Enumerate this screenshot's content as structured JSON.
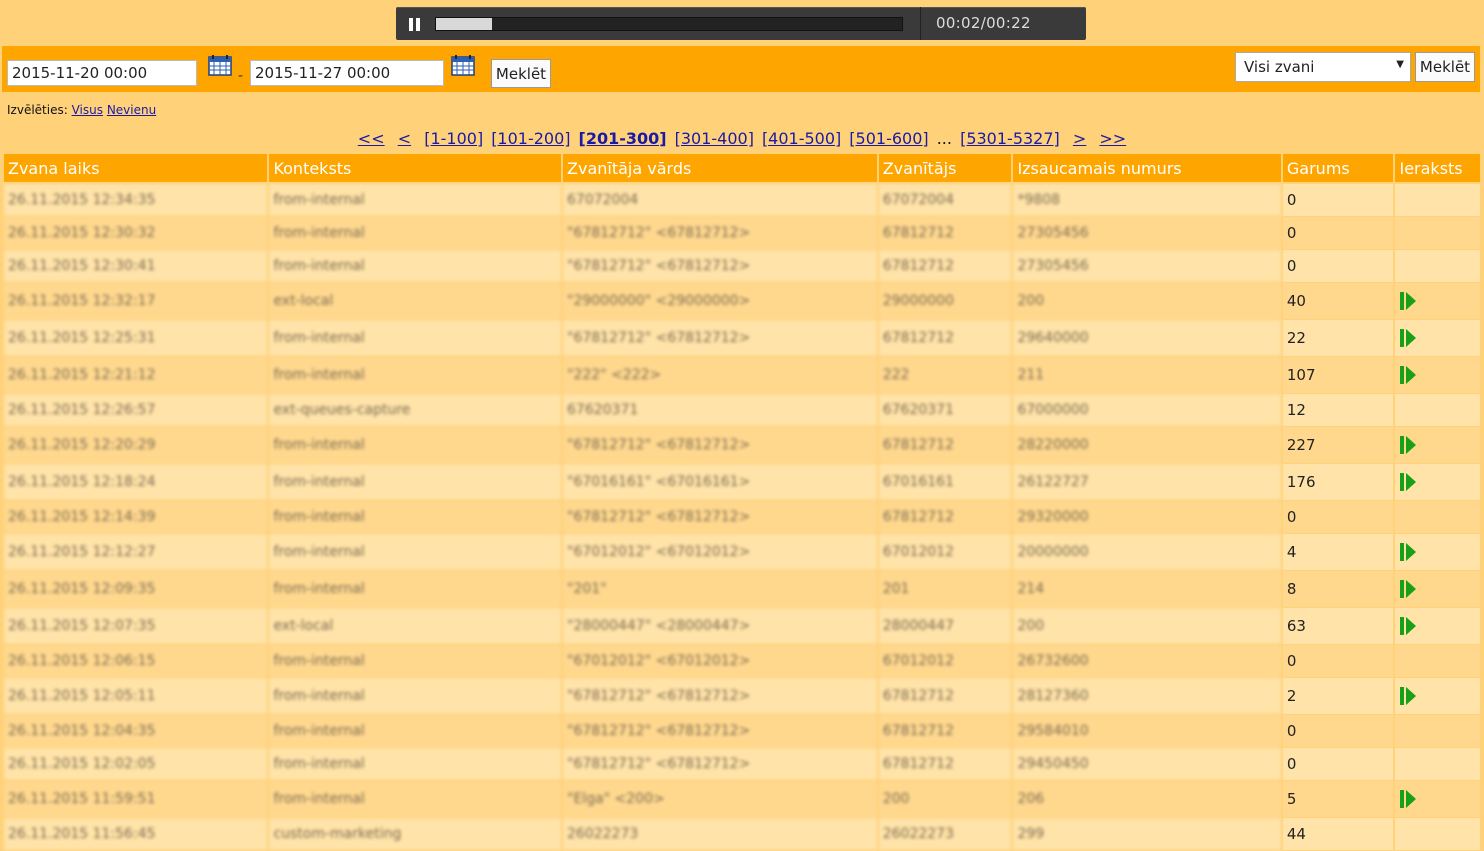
{
  "player": {
    "time": "00:02/00:22",
    "progress": 0.12
  },
  "filter": {
    "date_from": "2015-11-20 00:00",
    "separator": "-",
    "date_to": "2015-11-27 00:00",
    "search_label": "Meklēt",
    "call_filter": "Visi zvani",
    "search_label2": "Meklēt"
  },
  "choose": {
    "label": "Izvēlēties:",
    "all": "Visus",
    "none": "Nevienu"
  },
  "pager": {
    "first": "<<",
    "prev": "<",
    "pages": [
      "[1-100]",
      "[101-200]",
      "[201-300]",
      "[301-400]",
      "[401-500]",
      "[501-600]"
    ],
    "current_index": 2,
    "ellipsis": "...",
    "last_page": "[5301-5327]",
    "next": ">",
    "last": ">>"
  },
  "table": {
    "headers": [
      "Zvana laiks",
      "Konteksts",
      "Zvanītāja vārds",
      "Zvanītājs",
      "Izsaucamais numurs",
      "Garums",
      "Ieraksts"
    ],
    "rows": [
      {
        "time": "26.11.2015 12:34:35",
        "context": "from-internal",
        "name": "67072004",
        "caller": "67072004",
        "callee": "*9808",
        "duration": "0",
        "rec": false
      },
      {
        "time": "26.11.2015 12:30:32",
        "context": "from-internal",
        "name": "\"67812712\" <67812712>",
        "caller": "67812712",
        "callee": "27305456",
        "duration": "0",
        "rec": false
      },
      {
        "time": "26.11.2015 12:30:41",
        "context": "from-internal",
        "name": "\"67812712\" <67812712>",
        "caller": "67812712",
        "callee": "27305456",
        "duration": "0",
        "rec": false
      },
      {
        "time": "26.11.2015 12:32:17",
        "context": "ext-local",
        "name": "\"29000000\" <29000000>",
        "caller": "29000000",
        "callee": "200",
        "duration": "40",
        "rec": true
      },
      {
        "time": "26.11.2015 12:25:31",
        "context": "from-internal",
        "name": "\"67812712\" <67812712>",
        "caller": "67812712",
        "callee": "29640000",
        "duration": "22",
        "rec": true
      },
      {
        "time": "26.11.2015 12:21:12",
        "context": "from-internal",
        "name": "\"222\" <222>",
        "caller": "222",
        "callee": "211",
        "duration": "107",
        "rec": true
      },
      {
        "time": "26.11.2015 12:26:57",
        "context": "ext-queues-capture",
        "name": "67620371",
        "caller": "67620371",
        "callee": "67000000",
        "duration": "12",
        "rec": false
      },
      {
        "time": "26.11.2015 12:20:29",
        "context": "from-internal",
        "name": "\"67812712\" <67812712>",
        "caller": "67812712",
        "callee": "28220000",
        "duration": "227",
        "rec": true
      },
      {
        "time": "26.11.2015 12:18:24",
        "context": "from-internal",
        "name": "\"67016161\" <67016161>",
        "caller": "67016161",
        "callee": "26122727",
        "duration": "176",
        "rec": true
      },
      {
        "time": "26.11.2015 12:14:39",
        "context": "from-internal",
        "name": "\"67812712\" <67812712>",
        "caller": "67812712",
        "callee": "29320000",
        "duration": "0",
        "rec": false
      },
      {
        "time": "26.11.2015 12:12:27",
        "context": "from-internal",
        "name": "\"67012012\" <67012012>",
        "caller": "67012012",
        "callee": "20000000",
        "duration": "4",
        "rec": true
      },
      {
        "time": "26.11.2015 12:09:35",
        "context": "from-internal",
        "name": "\"201\"",
        "caller": "201",
        "callee": "214",
        "duration": "8",
        "rec": true
      },
      {
        "time": "26.11.2015 12:07:35",
        "context": "ext-local",
        "name": "\"28000447\" <28000447>",
        "caller": "28000447",
        "callee": "200",
        "duration": "63",
        "rec": true
      },
      {
        "time": "26.11.2015 12:06:15",
        "context": "from-internal",
        "name": "\"67012012\" <67012012>",
        "caller": "67012012",
        "callee": "26732600",
        "duration": "0",
        "rec": false
      },
      {
        "time": "26.11.2015 12:05:11",
        "context": "from-internal",
        "name": "\"67812712\" <67812712>",
        "caller": "67812712",
        "callee": "28127360",
        "duration": "2",
        "rec": true
      },
      {
        "time": "26.11.2015 12:04:35",
        "context": "from-internal",
        "name": "\"67812712\" <67812712>",
        "caller": "67812712",
        "callee": "29584010",
        "duration": "0",
        "rec": false
      },
      {
        "time": "26.11.2015 12:02:05",
        "context": "from-internal",
        "name": "\"67812712\" <67812712>",
        "caller": "67812712",
        "callee": "29450450",
        "duration": "0",
        "rec": false
      },
      {
        "time": "26.11.2015 11:59:51",
        "context": "from-internal",
        "name": "\"Elga\" <200>",
        "caller": "200",
        "callee": "206",
        "duration": "5",
        "rec": true
      },
      {
        "time": "26.11.2015 11:56:45",
        "context": "custom-marketing",
        "name": "26022273",
        "caller": "26022273",
        "callee": "299",
        "duration": "44",
        "rec": false
      }
    ]
  },
  "colors": {
    "bar": "#ffa500",
    "background": "#ffd27a",
    "play": "#18a018"
  }
}
